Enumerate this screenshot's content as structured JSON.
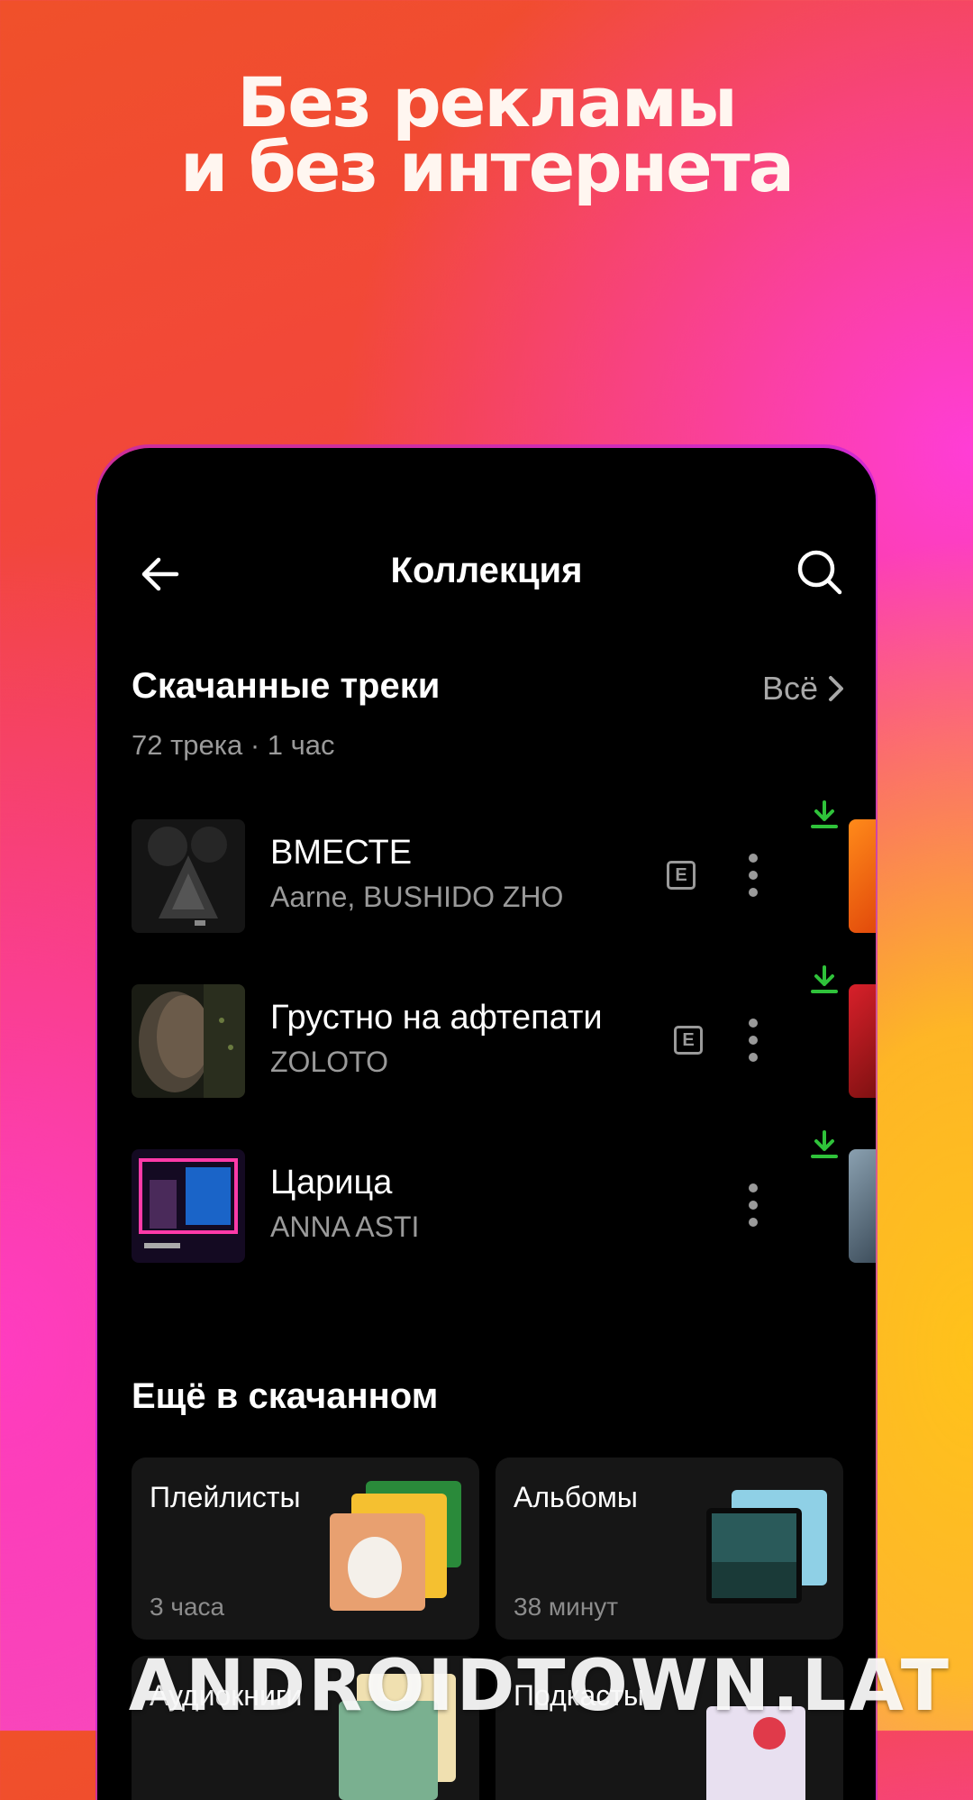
{
  "promo": {
    "line1": "Без рекламы",
    "line2": "и без интернета"
  },
  "header": {
    "title": "Коллекция",
    "back_icon": "arrow-left-icon",
    "search_icon": "search-icon"
  },
  "downloads": {
    "title": "Скачанные треки",
    "summary": "72 трека · 1 час",
    "see_all": "Всё"
  },
  "tracks": [
    {
      "title": "ВМЕСТЕ",
      "artist": "Aarne, BUSHIDO ZHO",
      "explicit": "E"
    },
    {
      "title": "Грустно на афтепати",
      "artist": "ZOLOTO",
      "explicit": "E"
    },
    {
      "title": "Царица",
      "artist": "ANNA ASTI",
      "explicit": ""
    }
  ],
  "more_section": {
    "title": "Ещё в скачанном"
  },
  "cards": [
    {
      "title": "Плейлисты",
      "subtitle": "3 часа"
    },
    {
      "title": "Альбомы",
      "subtitle": "38 минут"
    },
    {
      "title": "Аудиокниги",
      "subtitle": ""
    },
    {
      "title": "Подкасты",
      "subtitle": ""
    }
  ],
  "watermark": "ANDROIDTOWN.LAT",
  "colors": {
    "download_green": "#2fc23a",
    "background": "#000000"
  }
}
